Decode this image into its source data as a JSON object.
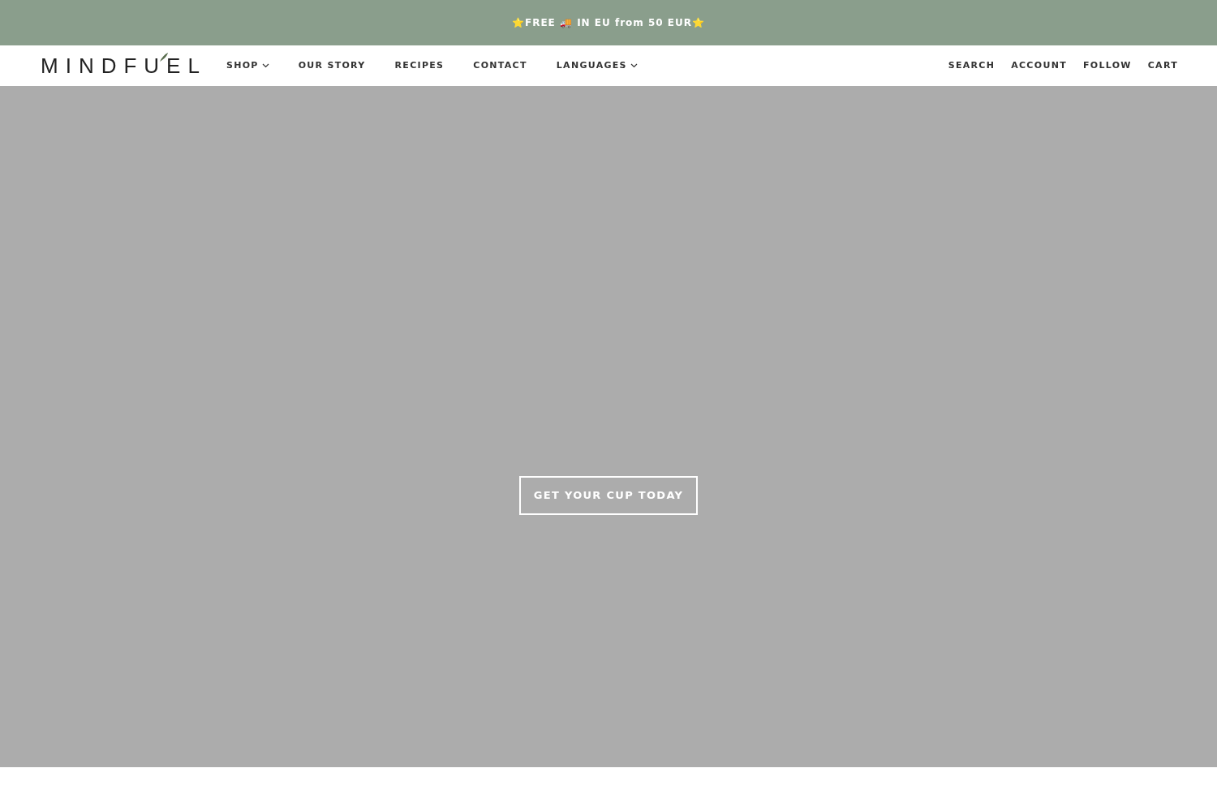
{
  "announcement": "⭐FREE 🚚 IN EU from 50 EUR⭐",
  "header": {
    "logo": "MINDFUEL",
    "nav": [
      {
        "label": "SHOP",
        "dropdown": true
      },
      {
        "label": "OUR STORY",
        "dropdown": false
      },
      {
        "label": "RECIPES",
        "dropdown": false
      },
      {
        "label": "CONTACT",
        "dropdown": false
      },
      {
        "label": "LANGUAGES",
        "dropdown": true
      }
    ],
    "actions": [
      "SEARCH",
      "ACCOUNT",
      "FOLLOW",
      "CART"
    ]
  },
  "hero": {
    "button": "GET YOUR CUP TODAY"
  }
}
